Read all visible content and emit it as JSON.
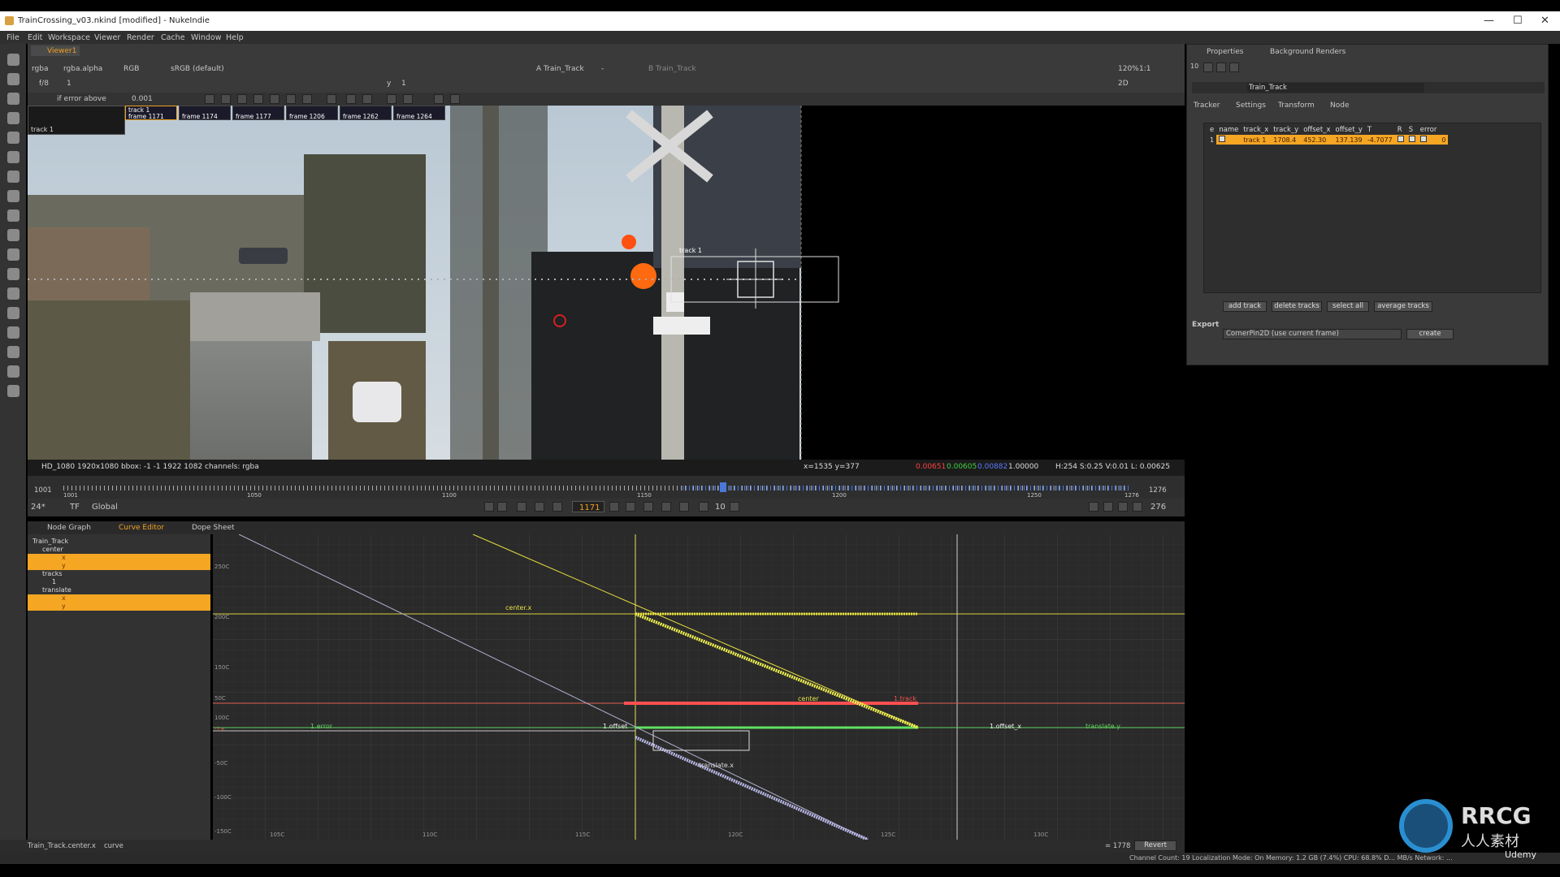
{
  "window": {
    "title": "TrainCrossing_v03.nkind [modified] - NukeIndie",
    "controls": [
      "—",
      "☐",
      "✕"
    ]
  },
  "menu": [
    "File",
    "Edit",
    "Workspace",
    "Viewer",
    "Render",
    "Cache",
    "Window",
    "Help"
  ],
  "viewer": {
    "tab": "Viewer1",
    "channels": "rgba",
    "alpha": "rgba.alpha",
    "colorspace_mode": "RGB",
    "lut": "sRGB (default)",
    "input_a": "A  Train_Track",
    "input_a_opt": "-",
    "input_b": "B  Train_Track",
    "zoom": "120%",
    "ratio": "1:1",
    "view_mode": "2D",
    "fstop": "f/8",
    "frame_step": "1",
    "y_label": "y",
    "y_val": "1",
    "error_mode": "if error above",
    "error_thresh": "0.001",
    "keyframes": [
      {
        "label": "track 1",
        "frame": "frame 1171"
      },
      {
        "label": "",
        "frame": "frame 1174"
      },
      {
        "label": "",
        "frame": "frame 1177"
      },
      {
        "label": "",
        "frame": "frame 1206"
      },
      {
        "label": "",
        "frame": "frame 1262"
      },
      {
        "label": "",
        "frame": "frame 1264"
      }
    ],
    "corner_label": "track 1",
    "track_label": "track 1",
    "info_left": "HD_1080 1920x1080  bbox: -1 -1 1922 1082 channels: rgba",
    "info_xy": "x=1535 y=377",
    "info_r": "0.00651",
    "info_g": "0.00605",
    "info_b": "0.00882",
    "info_a": "1.00000",
    "info_hsv": "H:254 S:0.25 V:0.01  L: 0.00625",
    "colors": {
      "r": "#ff4040",
      "g": "#40d040",
      "b": "#5a7aff"
    }
  },
  "timeline": {
    "start": "1001",
    "end": "1276",
    "ticks": [
      "1001",
      "1050",
      "1100",
      "1150",
      "1200",
      "1250",
      "1276"
    ],
    "fps": "24*",
    "tf": "TF",
    "scope": "Global",
    "current": "1171",
    "step": "10",
    "range_end": "276"
  },
  "lower_tabs": [
    "Node Graph",
    "Curve Editor",
    "Dope Sheet"
  ],
  "tree": [
    {
      "label": "Train_Track",
      "depth": 0
    },
    {
      "label": "center",
      "depth": 1
    },
    {
      "label": "x",
      "depth": 3,
      "selected": true
    },
    {
      "label": "y",
      "depth": 3,
      "selected": true
    },
    {
      "label": "tracks",
      "depth": 1
    },
    {
      "label": "1",
      "depth": 2
    },
    {
      "label": "translate",
      "depth": 1
    },
    {
      "label": "x",
      "depth": 3,
      "selected": true
    },
    {
      "label": "y",
      "depth": 3,
      "selected": true
    }
  ],
  "curve_editor": {
    "y_labels": [
      "250C",
      "200C",
      "150C",
      "100C",
      "50C",
      "-1+",
      "-50C",
      "-100C",
      "-150C"
    ],
    "x_labels": [
      "105C",
      "110C",
      "115C",
      "120C",
      "125C",
      "130C"
    ],
    "curve_labels": {
      "center_x": "center.x",
      "center_y": "center",
      "track": "1.track",
      "error": "1.error",
      "offset_a": "1.offset",
      "offset_b": "1.offset_x",
      "translate_y": "translate.y",
      "translate_x": "translate.x"
    }
  },
  "status": {
    "left": "Train_Track.center.x",
    "mode": "curve",
    "value": "= 1778",
    "revert": "Revert"
  },
  "bottom": "Channel Count: 19 Localization Mode: On Memory: 1.2 GB (7.4%) CPU: 68.8% D... MB/s Network: ...",
  "properties": {
    "tabs": [
      "Properties",
      "Background Renders"
    ],
    "max_panels": "10",
    "node_name": "Train_Track",
    "node_tabs": [
      "Tracker",
      "Settings",
      "Transform",
      "Node"
    ],
    "columns": [
      "e",
      "name",
      "track_x",
      "track_y",
      "offset_x",
      "offset_y",
      "T",
      "R",
      "S",
      "error"
    ],
    "rows": [
      {
        "index": "1",
        "name": "track 1",
        "track_x": "1708.4",
        "track_y": "452.30",
        "offset_x": "137.139",
        "offset_y": "-4.7077",
        "error": "0"
      }
    ],
    "buttons": [
      "add track",
      "delete tracks",
      "select all",
      "average tracks"
    ],
    "export_label": "Export",
    "export_value": "CornerPin2D (use current frame)",
    "create": "create"
  },
  "watermark": {
    "brand": "RRCG",
    "sub": "人人素材",
    "site": "Udemy"
  }
}
